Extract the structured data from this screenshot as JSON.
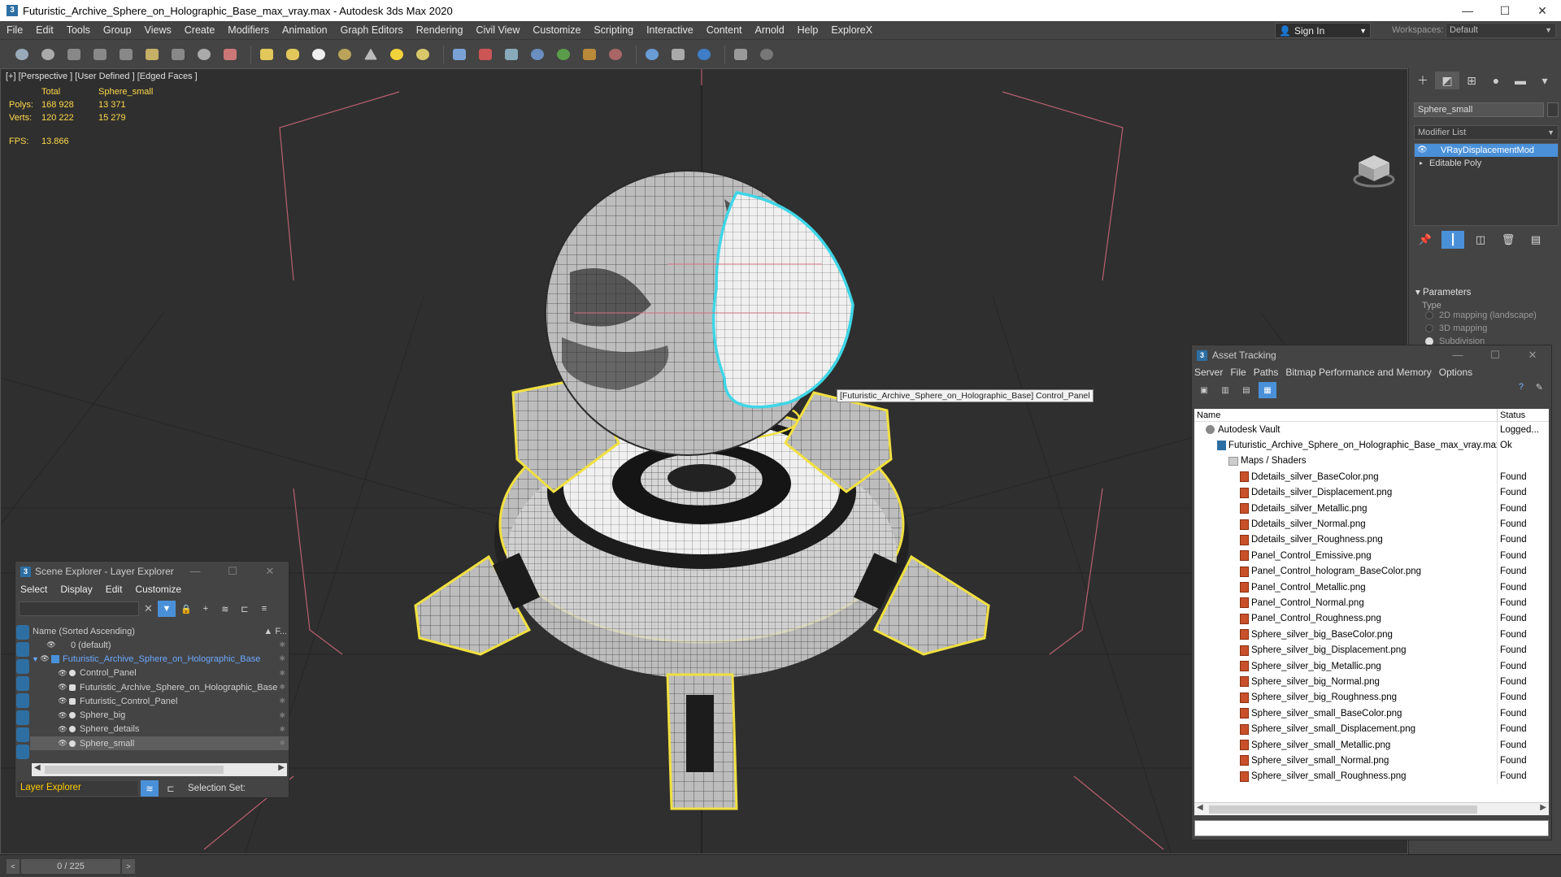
{
  "window": {
    "title": "Futuristic_Archive_Sphere_on_Holographic_Base_max_vray.max - Autodesk 3ds Max 2020",
    "minimize": "—",
    "maximize": "☐",
    "close": "✕"
  },
  "menu": [
    "File",
    "Edit",
    "Tools",
    "Group",
    "Views",
    "Create",
    "Modifiers",
    "Animation",
    "Graph Editors",
    "Rendering",
    "Civil View",
    "Customize",
    "Scripting",
    "Interactive",
    "Content",
    "Arnold",
    "Help",
    "ExploreX"
  ],
  "account": {
    "sign_in": "Sign In",
    "workspaces_label": "Workspaces:",
    "workspace": "Default"
  },
  "viewport": {
    "label": "[+] [Perspective ] [User Defined ] [Edged Faces ]",
    "stats": {
      "col_total": "Total",
      "col_object": "Sphere_small",
      "polys_label": "Polys:",
      "polys_total": "168 928",
      "polys_object": "13 371",
      "verts_label": "Verts:",
      "verts_total": "120 222",
      "verts_object": "15 279",
      "fps_label": "FPS:",
      "fps_value": "13.866"
    },
    "tooltip": "[Futuristic_Archive_Sphere_on_Holographic_Base] Control_Panel"
  },
  "command_panel": {
    "object_name": "Sphere_small",
    "modifier_list": "Modifier List",
    "stack": [
      "VRayDisplacementMod",
      "Editable Poly"
    ],
    "parameters_title": "Parameters",
    "type_label": "Type",
    "options": [
      "2D mapping (landscape)",
      "3D mapping",
      "Subdivision"
    ],
    "selected_option": "Subdivision"
  },
  "asset_tracking": {
    "title": "Asset Tracking",
    "menu": [
      "Server",
      "File",
      "Paths",
      "Bitmap Performance and Memory",
      "Options"
    ],
    "col_name": "Name",
    "col_status": "Status",
    "vault": {
      "name": "Autodesk Vault",
      "status": "Logged..."
    },
    "max_file": {
      "name": "Futuristic_Archive_Sphere_on_Holographic_Base_max_vray.max",
      "status": "Ok"
    },
    "maps_folder": "Maps / Shaders",
    "files": [
      {
        "name": "Ddetails_silver_BaseColor.png",
        "status": "Found"
      },
      {
        "name": "Ddetails_silver_Displacement.png",
        "status": "Found"
      },
      {
        "name": "Ddetails_silver_Metallic.png",
        "status": "Found"
      },
      {
        "name": "Ddetails_silver_Normal.png",
        "status": "Found"
      },
      {
        "name": "Ddetails_silver_Roughness.png",
        "status": "Found"
      },
      {
        "name": "Panel_Control_Emissive.png",
        "status": "Found"
      },
      {
        "name": "Panel_Control_hologram_BaseColor.png",
        "status": "Found"
      },
      {
        "name": "Panel_Control_Metallic.png",
        "status": "Found"
      },
      {
        "name": "Panel_Control_Normal.png",
        "status": "Found"
      },
      {
        "name": "Panel_Control_Roughness.png",
        "status": "Found"
      },
      {
        "name": "Sphere_silver_big_BaseColor.png",
        "status": "Found"
      },
      {
        "name": "Sphere_silver_big_Displacement.png",
        "status": "Found"
      },
      {
        "name": "Sphere_silver_big_Metallic.png",
        "status": "Found"
      },
      {
        "name": "Sphere_silver_big_Normal.png",
        "status": "Found"
      },
      {
        "name": "Sphere_silver_big_Roughness.png",
        "status": "Found"
      },
      {
        "name": "Sphere_silver_small_BaseColor.png",
        "status": "Found"
      },
      {
        "name": "Sphere_silver_small_Displacement.png",
        "status": "Found"
      },
      {
        "name": "Sphere_silver_small_Metallic.png",
        "status": "Found"
      },
      {
        "name": "Sphere_silver_small_Normal.png",
        "status": "Found"
      },
      {
        "name": "Sphere_silver_small_Roughness.png",
        "status": "Found"
      }
    ]
  },
  "scene_explorer": {
    "title": "Scene Explorer - Layer Explorer",
    "menu": [
      "Select",
      "Display",
      "Edit",
      "Customize"
    ],
    "column": "Name (Sorted Ascending)",
    "column_right": "▲ F...",
    "rows": [
      {
        "label": "0 (default)"
      },
      {
        "label": "Futuristic_Archive_Sphere_on_Holographic_Base"
      },
      {
        "label": "Control_Panel"
      },
      {
        "label": "Futuristic_Archive_Sphere_on_Holographic_Base"
      },
      {
        "label": "Futuristic_Control_Panel"
      },
      {
        "label": "Sphere_big"
      },
      {
        "label": "Sphere_details"
      },
      {
        "label": "Sphere_small"
      }
    ],
    "explorer_mode": "Layer Explorer",
    "selection_set": "Selection Set:"
  },
  "timeline": {
    "frame": "0 / 225",
    "prev": "<",
    "next": ">"
  },
  "colors": {
    "ui_bg": "#444444",
    "viewport_bg": "#2f2f2f",
    "selection_accent": "#4a90d9",
    "stats_text": "#ffd94a",
    "highlight_yellow": "#f0e040",
    "highlight_cyan": "#3fd6e6"
  }
}
